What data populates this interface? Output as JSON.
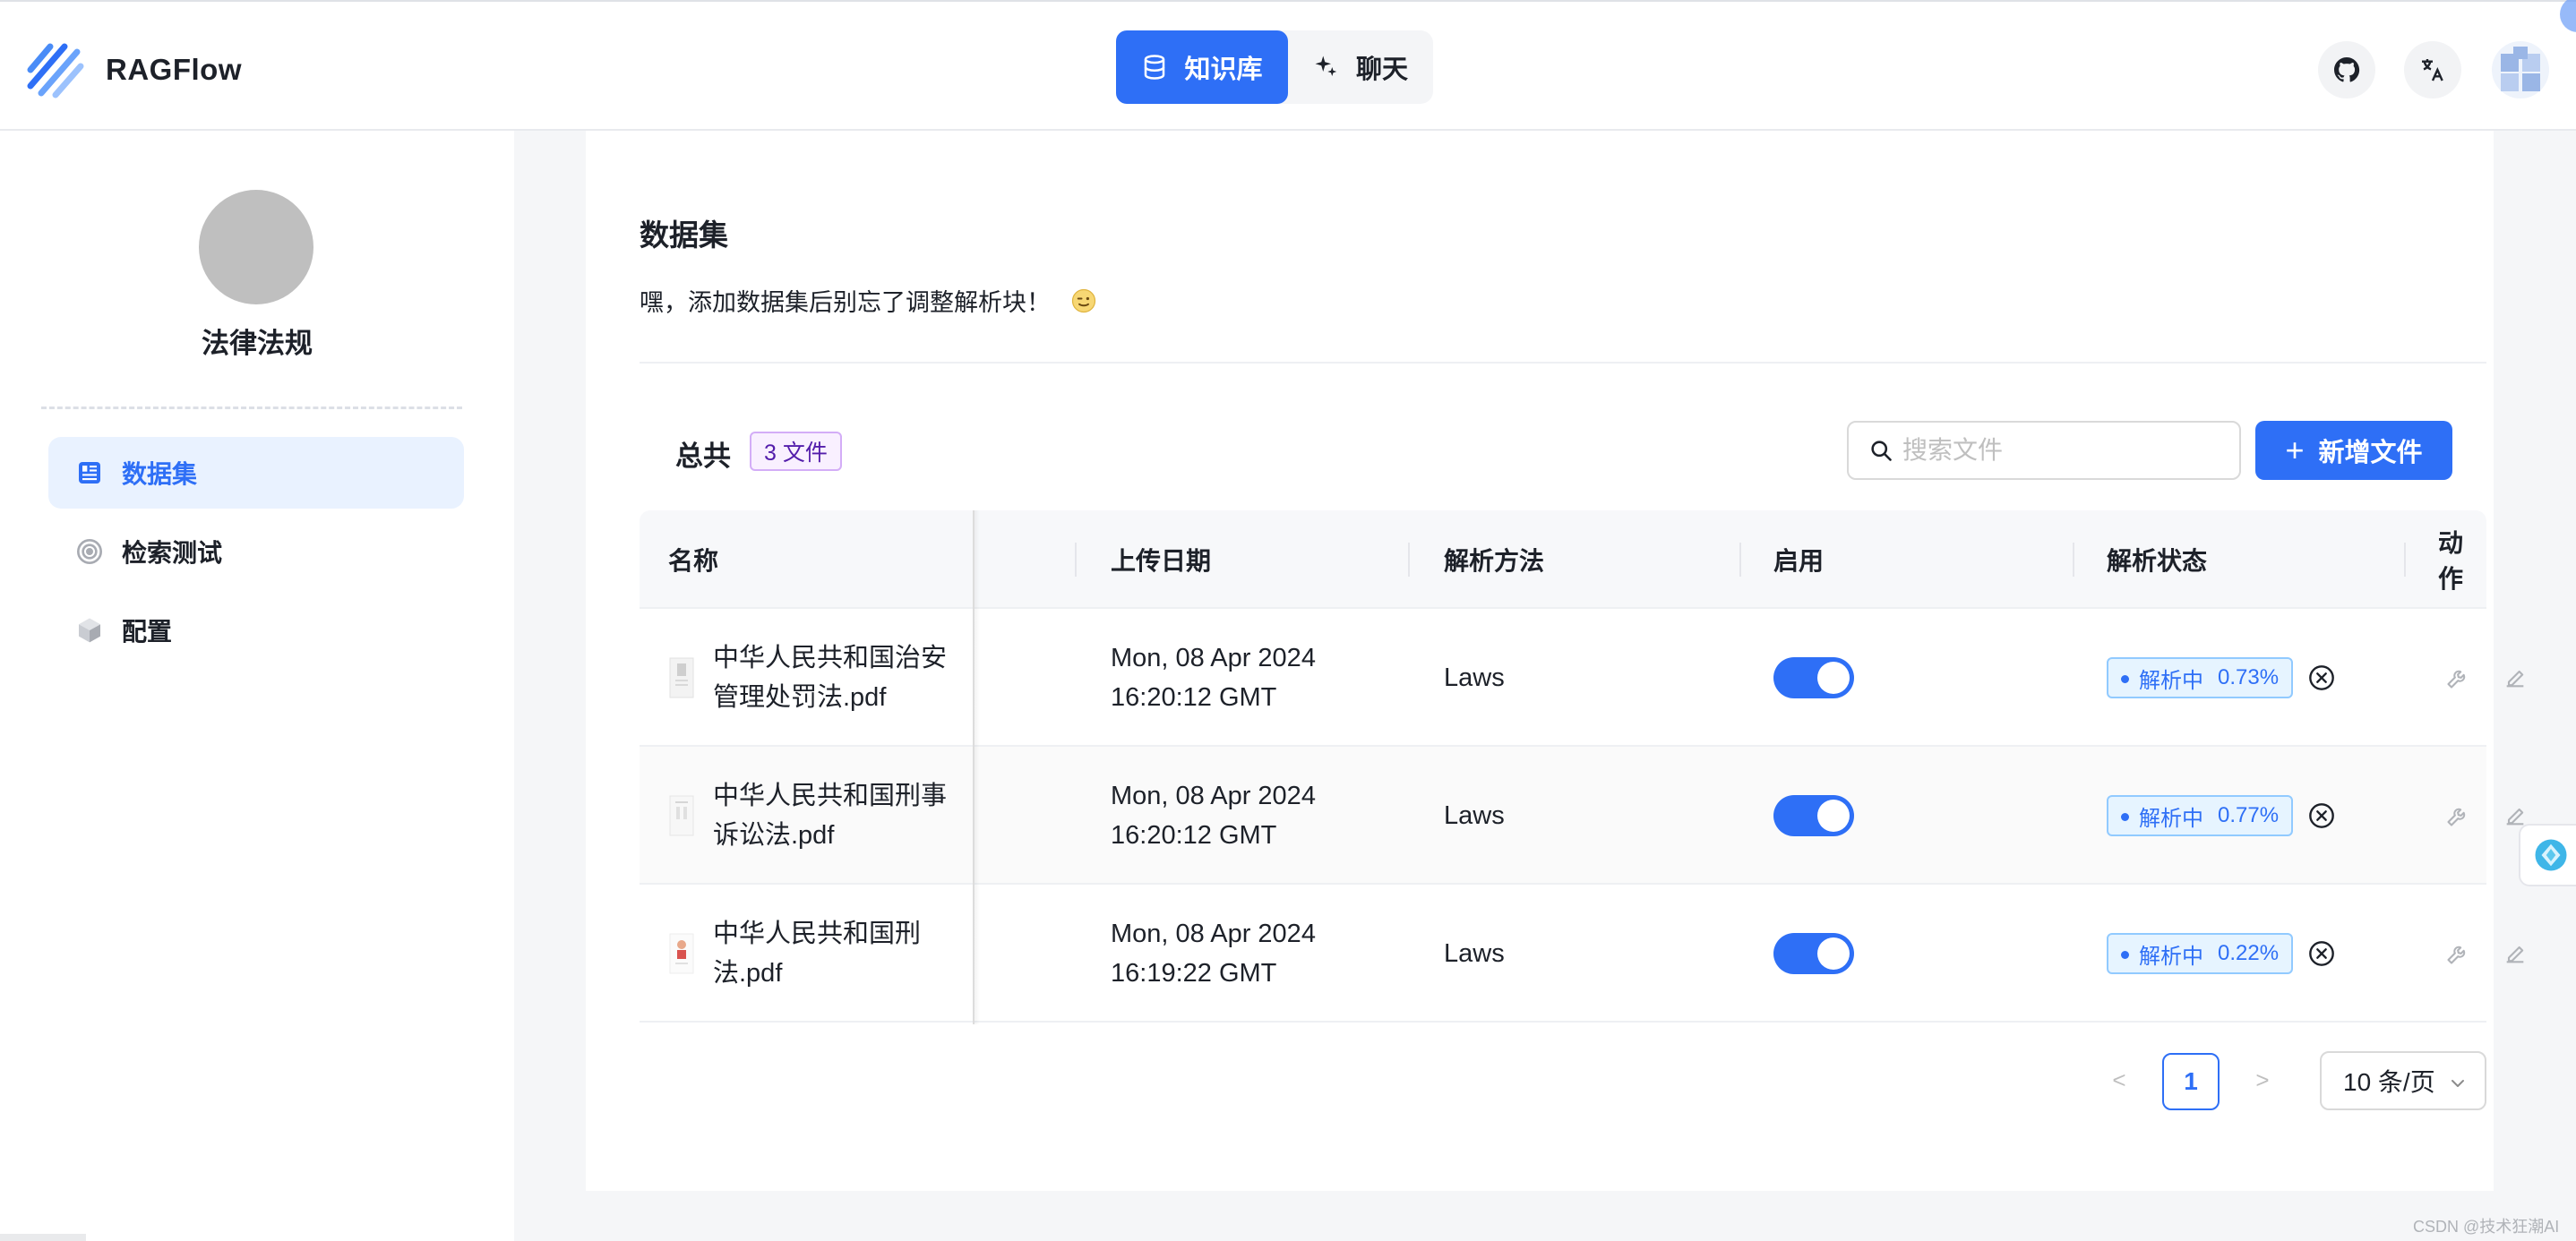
{
  "brand": {
    "name": "RAGFlow"
  },
  "nav": {
    "tabs": [
      {
        "label": "知识库",
        "active": true
      },
      {
        "label": "聊天",
        "active": false
      }
    ]
  },
  "header_actions": {
    "icons": [
      "github-icon",
      "translate-icon",
      "user-avatar"
    ]
  },
  "sidebar": {
    "kb_name": "法律法规",
    "items": [
      {
        "label": "数据集",
        "active": true,
        "icon": "dataset-icon"
      },
      {
        "label": "检索测试",
        "active": false,
        "icon": "target-icon"
      },
      {
        "label": "配置",
        "active": false,
        "icon": "cube-icon"
      }
    ]
  },
  "main": {
    "title": "数据集",
    "tip": "嘿，添加数据集后别忘了调整解析块！",
    "total_label": "总共",
    "total_badge": "3 文件",
    "search_placeholder": "搜索文件",
    "add_button": "新增文件",
    "columns": [
      "名称",
      "上传日期",
      "解析方法",
      "启用",
      "解析状态",
      "动作"
    ],
    "rows": [
      {
        "name": "中华人民共和国治安管理处罚法.pdf",
        "date_line1": "Mon, 08 Apr 2024",
        "date_line2": "16:20:12 GMT",
        "method": "Laws",
        "enabled": true,
        "status": "解析中",
        "progress": "0.73%"
      },
      {
        "name": "中华人民共和国刑事诉讼法.pdf",
        "date_line1": "Mon, 08 Apr 2024",
        "date_line2": "16:20:12 GMT",
        "method": "Laws",
        "enabled": true,
        "status": "解析中",
        "progress": "0.77%"
      },
      {
        "name": "中华人民共和国刑法.pdf",
        "date_line1": "Mon, 08 Apr 2024",
        "date_line2": "16:19:22 GMT",
        "method": "Laws",
        "enabled": true,
        "status": "解析中",
        "progress": "0.22%"
      }
    ],
    "pagination": {
      "prev": "<",
      "current": "1",
      "next": ">",
      "page_size": "10 条/页"
    }
  },
  "colors": {
    "primary": "#2e6ff6",
    "tag_bg": "#e6f4ff",
    "badge_border": "#d3adf7"
  },
  "watermark": "CSDN @技术狂潮AI"
}
